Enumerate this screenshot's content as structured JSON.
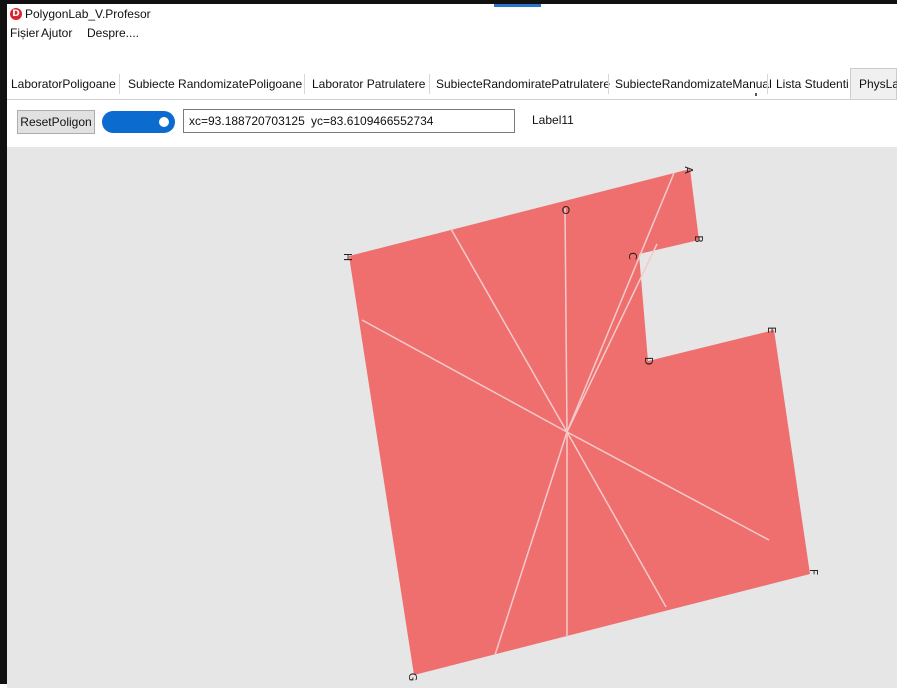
{
  "window": {
    "title": "PolygonLab_V.Profesor",
    "icon_letter": "D"
  },
  "menu": {
    "items": [
      "Fișier",
      "Ajutor",
      "Despre...."
    ]
  },
  "tabs": [
    "LaboratorPoligoane",
    "Subiecte RandomizatePoligoane",
    "Laborator Patrulatere",
    "SubiecteRandomiratePatrulatere",
    "SubiecteRandomizateManual",
    "Lista Studenti",
    "PhysLab"
  ],
  "active_tab": "PhysLab",
  "toolbar": {
    "reset_label": "ResetPoligon",
    "toggle_state": "on",
    "xc_text": "xc=93.188720703125",
    "yc_text": "yc=83.6109466552734",
    "label11": "Label11"
  },
  "polygon": {
    "vertex_labels": [
      "A",
      "B",
      "C",
      "D",
      "E",
      "F",
      "G",
      "H"
    ],
    "center_label": "O",
    "fill_color": "#ef6f6f",
    "ray_color": "#f3caca"
  },
  "colors": {
    "canvas_bg": "#e6e6e6",
    "toggle_blue": "#0b6bcf",
    "brand_red": "#d9252d"
  }
}
